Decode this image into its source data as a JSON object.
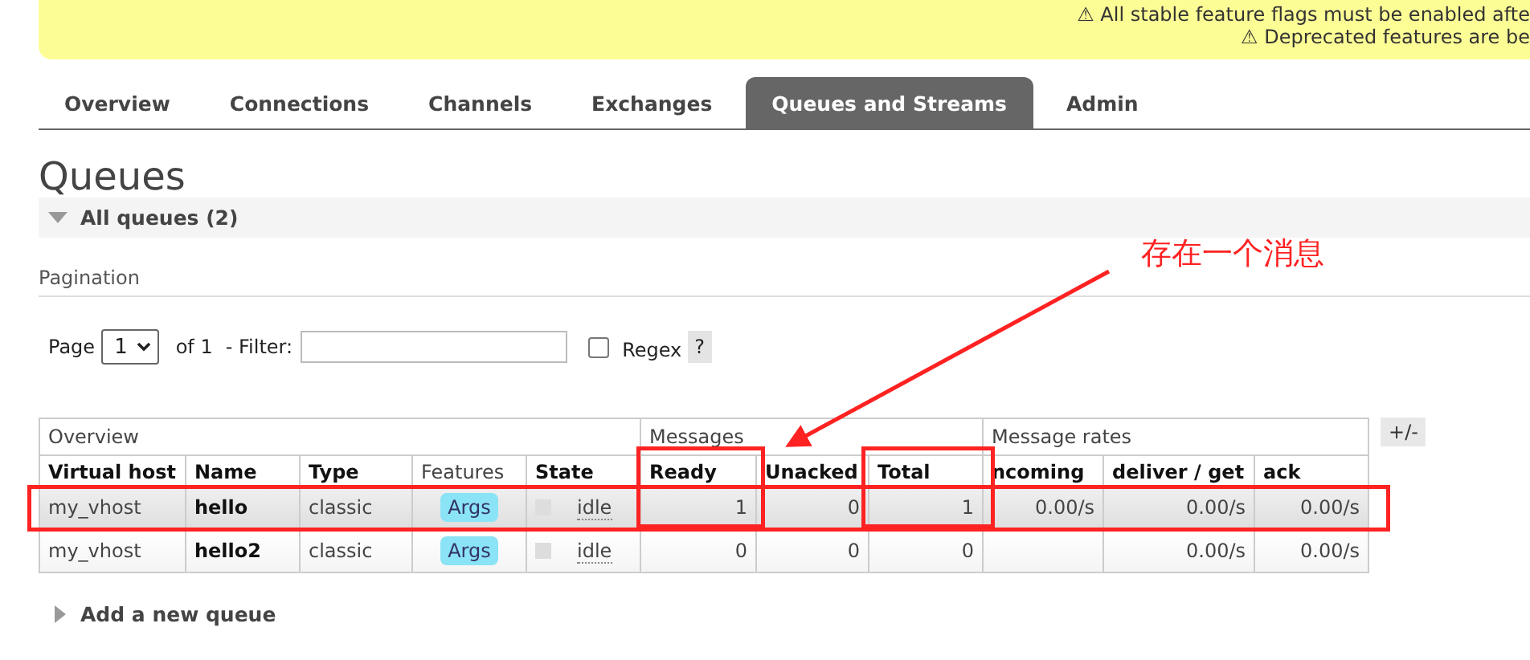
{
  "banner": {
    "lines": [
      "⚠ All stable feature flags must be enabled afte",
      "⚠ Deprecated features are be"
    ]
  },
  "tabs": [
    {
      "label": "Overview",
      "selected": false
    },
    {
      "label": "Connections",
      "selected": false
    },
    {
      "label": "Channels",
      "selected": false
    },
    {
      "label": "Exchanges",
      "selected": false
    },
    {
      "label": "Queues and Streams",
      "selected": true
    },
    {
      "label": "Admin",
      "selected": false
    }
  ],
  "page_title": "Queues",
  "section": {
    "title": "All queues (2)",
    "expanded": true
  },
  "pagination": {
    "heading": "Pagination",
    "page_label": "Page",
    "page_value": "1",
    "of_label": "of 1",
    "filter_label": "- Filter:",
    "regex_label": "Regex",
    "regex_checked": false,
    "help": "?"
  },
  "table": {
    "groups": [
      "Overview",
      "Messages",
      "Message rates"
    ],
    "columns": [
      "Virtual host",
      "Name",
      "Type",
      "Features",
      "State",
      "Ready",
      "Unacked",
      "Total",
      "ncoming",
      "deliver / get",
      "ack"
    ],
    "rows": [
      {
        "highlighted": true,
        "vhost": "my_vhost",
        "name": "hello",
        "type": "classic",
        "feature": "Args",
        "state": "idle",
        "ready": "1",
        "unacked": "0",
        "total": "1",
        "incoming": "0.00/s",
        "deliver": "0.00/s",
        "ack": "0.00/s"
      },
      {
        "highlighted": false,
        "vhost": "my_vhost",
        "name": "hello2",
        "type": "classic",
        "feature": "Args",
        "state": "idle",
        "ready": "0",
        "unacked": "0",
        "total": "0",
        "deliver": "0.00/s",
        "ack": "0.00/s"
      }
    ],
    "toggle": "+/-"
  },
  "add_queue": {
    "title": "Add a new queue",
    "expanded": false
  },
  "annotation": {
    "text": "存在一个消息"
  }
}
